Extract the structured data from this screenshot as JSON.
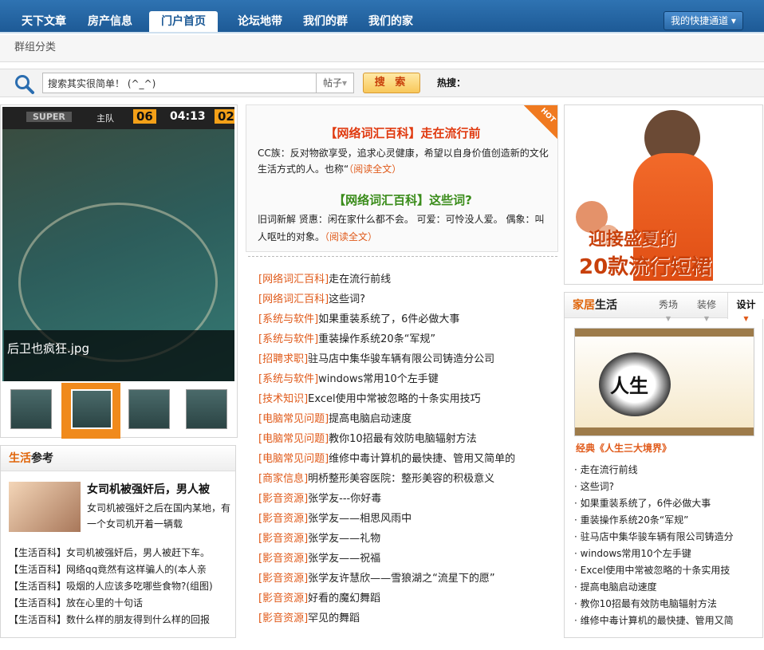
{
  "nav": {
    "tabs": [
      "天下文章",
      "房产信息",
      "门户首页",
      "论坛地带",
      "我们的群",
      "我们的家"
    ],
    "active_index": 2,
    "quick_link": "我的快捷通道"
  },
  "subnav": {
    "label": "群组分类"
  },
  "search": {
    "value": "搜索其实很简单！ (^_^)",
    "type": "帖子",
    "button": "搜 索",
    "hot_label": "热搜："
  },
  "slideshow": {
    "caption": "后卫也疯狂.jpg",
    "hud": {
      "team": "主队",
      "score": "06",
      "time": "04:13",
      "score2": "02",
      "brand": "SUPER"
    },
    "selected_thumb": 1
  },
  "life": {
    "header_accent": "生活",
    "header_rest": "参考",
    "feature_title": "女司机被强奸后，男人被",
    "feature_desc": "女司机被强奸之后在国内某地，有一个女司机开着一辆载",
    "items": [
      "【生活百科】女司机被强奸后，男人被赶下车。",
      "【生活百科】网络qq竟然有这样骗人的(本人亲",
      "【生活百科】吸烟的人应该多吃哪些食物?(组图)",
      "【生活百科】放在心里的十句话",
      "【生活百科】数什么样的朋友得到什么样的回报"
    ]
  },
  "hot": {
    "flag": "HOT",
    "item1_title": "【网络词汇百科】走在流行前",
    "item1_desc": "CC族：反对物欲享受，追求心灵健康，希望以自身价值创造新的文化生活方式的人。也称“",
    "item1_more": "（阅读全文）",
    "item2_title": "【网络词汇百科】这些词?",
    "item2_desc": "旧词新解 贤惠：闲在家什么都不会。 可爱：可怜没人爱。 偶象：叫人呕吐的对象。",
    "item2_more": "（阅读全文）"
  },
  "articles": [
    {
      "cat": "[网络词汇百科]",
      "title": "走在流行前线"
    },
    {
      "cat": "[网络词汇百科]",
      "title": "这些词?"
    },
    {
      "cat": "[系统与软件]",
      "title": "如果重装系统了，6件必做大事"
    },
    {
      "cat": "[系统与软件]",
      "title": "重装操作系统20条“军规”"
    },
    {
      "cat": "[招聘求职]",
      "title": "驻马店中集华骏车辆有限公司铸造分公司"
    },
    {
      "cat": "[系统与软件]",
      "title": "windows常用10个左手键"
    },
    {
      "cat": "[技术知识]",
      "title": "Excel使用中常被忽略的十条实用技巧"
    },
    {
      "cat": "[电脑常见问题]",
      "title": "提高电脑启动速度"
    },
    {
      "cat": "[电脑常见问题]",
      "title": "教你10招最有效防电脑辐射方法"
    },
    {
      "cat": "[电脑常见问题]",
      "title": "维修中毒计算机的最快捷、管用又简单的"
    },
    {
      "cat": "[商家信息]",
      "title": "明桥整形美容医院：整形美容的积极意义"
    },
    {
      "cat": "[影音资源]",
      "title": "张学友---你好毒"
    },
    {
      "cat": "[影音资源]",
      "title": "张学友——相思风雨中"
    },
    {
      "cat": "[影音资源]",
      "title": "张学友——礼物"
    },
    {
      "cat": "[影音资源]",
      "title": "张学友——祝福"
    },
    {
      "cat": "[影音资源]",
      "title": "张学友许慧欣——雪狼湖之“流星下的愿”"
    },
    {
      "cat": "[影音资源]",
      "title": "好看的魔幻舞蹈"
    },
    {
      "cat": "[影音资源]",
      "title": "罕见的舞蹈"
    }
  ],
  "ad": {
    "line1": "迎接盛夏的",
    "line2": "20款流行短裙"
  },
  "home": {
    "header_accent": "家居",
    "header_rest": "生活",
    "tabs": [
      "秀场",
      "装修",
      "设计"
    ],
    "active_tab": 2,
    "image_text": "人生",
    "feature": "经典《人生三大境界》",
    "items": [
      "走在流行前线",
      "这些词?",
      "如果重装系统了，6件必做大事",
      "重装操作系统20条“军规”",
      "驻马店中集华骏车辆有限公司铸造分",
      "windows常用10个左手键",
      "Excel使用中常被忽略的十条实用技",
      "提高电脑启动速度",
      "教你10招最有效防电脑辐射方法",
      "维修中毒计算机的最快捷、管用又简"
    ]
  }
}
